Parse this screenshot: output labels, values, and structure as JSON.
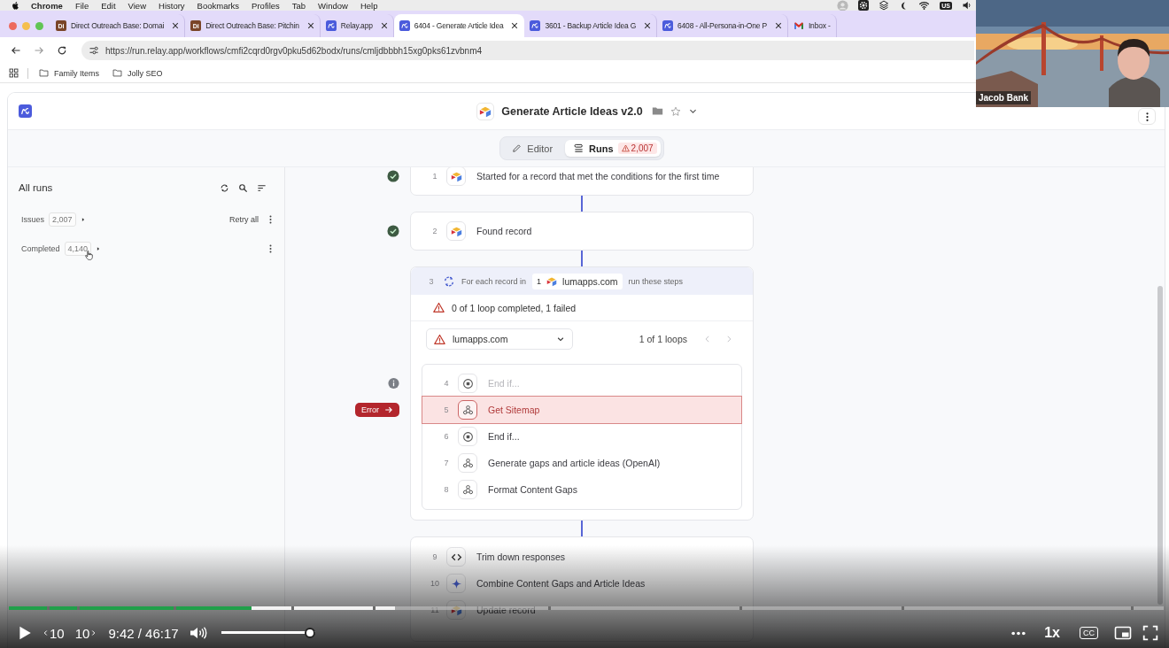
{
  "menubar": {
    "app": "Chrome",
    "menus": [
      "File",
      "Edit",
      "View",
      "History",
      "Bookmarks",
      "Profiles",
      "Tab",
      "Window",
      "Help"
    ],
    "input_source": "US"
  },
  "tabs": [
    {
      "title": "Direct Outreach Base: Domai",
      "kind": "letters",
      "icon_text": "Di",
      "selected": false
    },
    {
      "title": "Direct Outreach Base: Pitchin",
      "kind": "letters",
      "icon_text": "Di",
      "selected": false
    },
    {
      "title": "Relay.app",
      "kind": "relay",
      "selected": false
    },
    {
      "title": "6404 - Generate Article Idea",
      "kind": "relay",
      "selected": true
    },
    {
      "title": "3601 - Backup Article Idea G",
      "kind": "relay",
      "selected": false
    },
    {
      "title": "6408 - All-Persona-in-One P",
      "kind": "relay",
      "selected": false
    },
    {
      "title": "Inbox -",
      "kind": "mail",
      "selected": false
    }
  ],
  "address_bar": {
    "url": "https://run.relay.app/workflows/cmfi2cqrd0rgv0pku5d62bodx/runs/cmljdbbbh15xg0pks61zvbnm4"
  },
  "bookmarks": [
    "Family Items",
    "Jolly SEO"
  ],
  "workflow": {
    "title": "Generate Article Ideas v2.0",
    "starred": false
  },
  "view_switch": [
    {
      "label": "Editor",
      "kind": "pencil",
      "selected": false
    },
    {
      "label": "Runs",
      "kind": "list",
      "selected": true,
      "badge": "2,007"
    }
  ],
  "runs_panel": {
    "title": "All runs",
    "groups": [
      {
        "label": "Issues",
        "count": "2,007",
        "action": "Retry all",
        "hovered": false
      },
      {
        "label": "Completed",
        "count": "4,140",
        "hovered": true
      }
    ]
  },
  "flow": [
    {
      "kind": "card",
      "steps": [
        {
          "number": "1",
          "kind": "blocks",
          "label": "Started for a record that met the conditions for the first time",
          "completed": true,
          "skipped": false,
          "failed": false
        }
      ]
    },
    {
      "kind": "card",
      "steps": [
        {
          "number": "2",
          "kind": "blocks",
          "label": "Found record",
          "completed": true,
          "skipped": false,
          "failed": false
        }
      ]
    },
    {
      "kind": "loop",
      "number": "3",
      "label_before": "For each record in",
      "source_count": "1",
      "source": "lumapps.com",
      "label_after": "run these steps",
      "summary": "0 of 1 loop completed, 1 failed",
      "selector": "lumapps.com",
      "pager": {
        "label": "1 of 1 loops",
        "previous_disabled": true,
        "next_disabled": true
      },
      "steps": [
        {
          "number": "4",
          "kind": "stop",
          "label": "End if...",
          "completed": false,
          "skipped": true,
          "failed": false,
          "dimmed": true
        },
        {
          "number": "5",
          "kind": "webhook",
          "label": "Get Sitemap",
          "completed": false,
          "skipped": false,
          "failed": true,
          "error_label": "Error",
          "dimmed": false
        },
        {
          "number": "6",
          "kind": "stop",
          "label": "End if...",
          "completed": false,
          "skipped": false,
          "failed": false,
          "dimmed": false
        },
        {
          "number": "7",
          "kind": "webhook",
          "label": "Generate gaps and article ideas (OpenAI)",
          "completed": false,
          "skipped": false,
          "failed": false,
          "dimmed": false
        },
        {
          "number": "8",
          "kind": "webhook",
          "label": "Format Content Gaps",
          "completed": false,
          "skipped": false,
          "failed": false,
          "dimmed": false
        }
      ]
    },
    {
      "kind": "card",
      "steps": [
        {
          "number": "9",
          "kind": "code",
          "label": "Trim down responses",
          "completed": false,
          "skipped": false,
          "failed": false
        },
        {
          "number": "10",
          "kind": "sparkle",
          "label": "Combine Content Gaps and Article Ideas",
          "completed": false,
          "skipped": false,
          "failed": false
        },
        {
          "number": "11",
          "kind": "blocks",
          "label": "Update record",
          "completed": false,
          "skipped": false,
          "failed": false
        }
      ]
    }
  ],
  "webcam": {
    "kind": "picture",
    "name": "Jacob Bank"
  },
  "player": {
    "playing": false,
    "back_label": "10",
    "forward_label": "10",
    "time": "9:42 / 46:17",
    "volume": {
      "level": 1.0
    },
    "progress": {
      "level": 0.21
    },
    "buffered": {
      "level": 0.334
    },
    "speed": "1x",
    "captions": "CC"
  }
}
